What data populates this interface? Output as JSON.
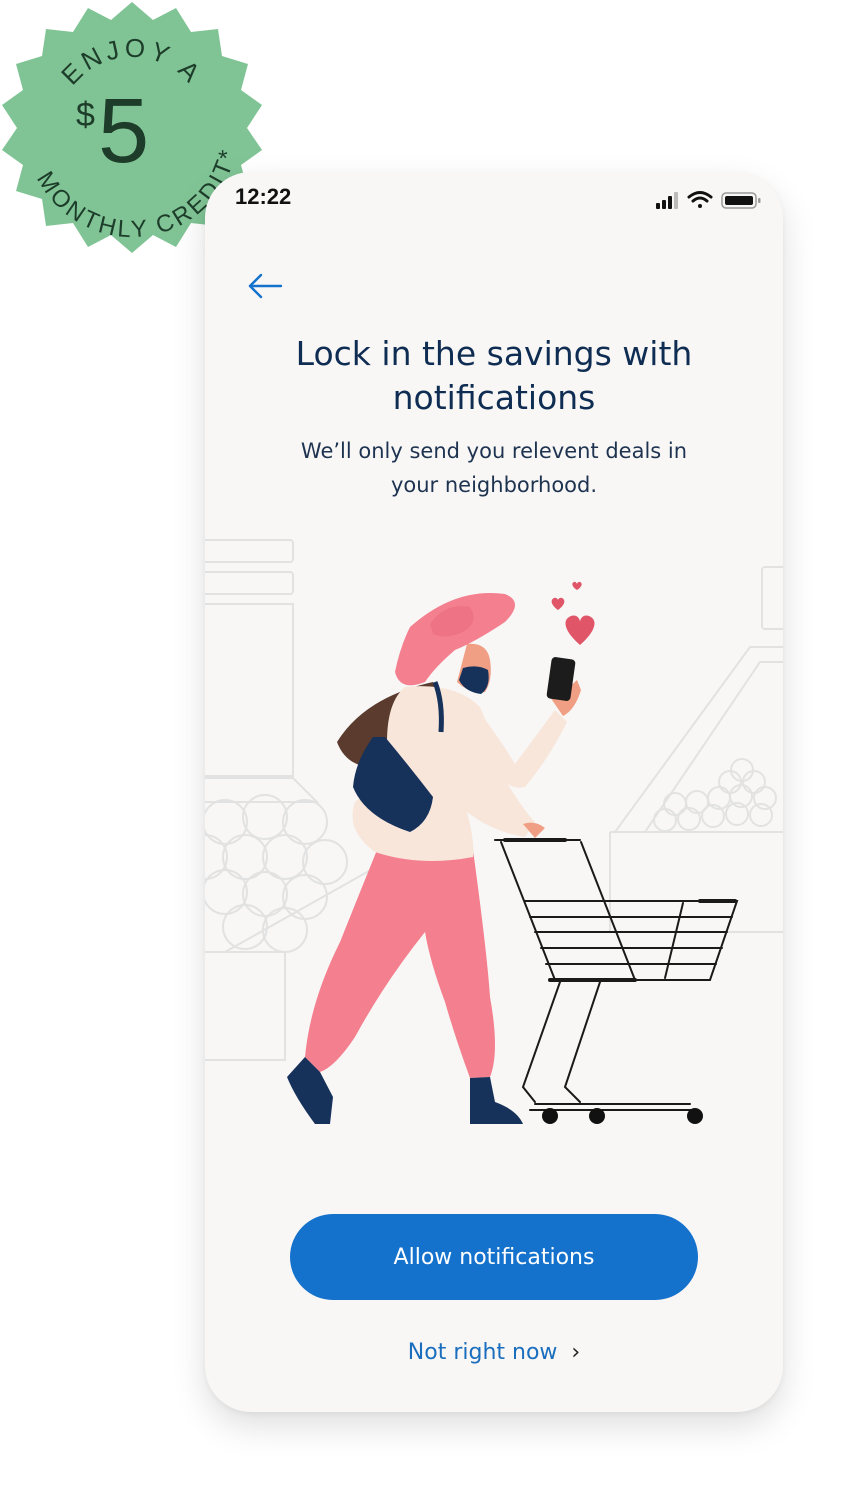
{
  "badge": {
    "arc_top": "ENJOY A",
    "currency": "$",
    "amount": "5",
    "arc_bottom": "MONTHLY CREDIT*",
    "color": "#80c495"
  },
  "status_bar": {
    "time": "12:22",
    "icons": [
      "signal-icon",
      "wifi-icon",
      "battery-icon"
    ]
  },
  "nav": {
    "back_icon": "arrow-left-icon"
  },
  "content": {
    "title_line1": "Lock in the savings with",
    "title_line2": "notifications",
    "subtitle_line1": "We’ll only send you relevent deals in",
    "subtitle_line2": "your neighborhood."
  },
  "actions": {
    "allow_label": "Allow notifications",
    "skip_label": "Not right now",
    "skip_icon": "chevron-right-icon"
  },
  "colors": {
    "primary": "#1472cc",
    "title": "#0f2d52",
    "link": "#1a6ebd",
    "pants": "#f4808f",
    "heart": "#e05567"
  }
}
